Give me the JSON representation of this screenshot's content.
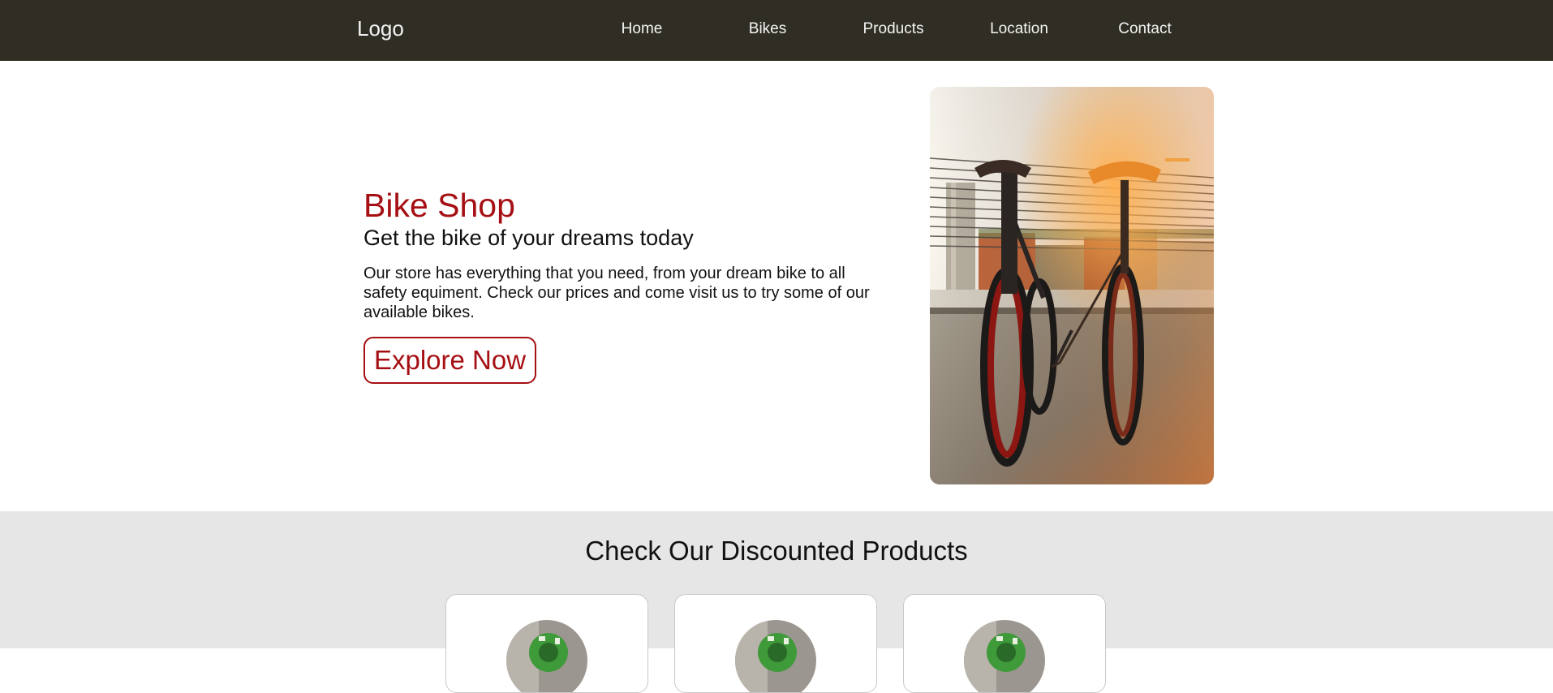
{
  "nav": {
    "logo": "Logo",
    "links": [
      "Home",
      "Bikes",
      "Products",
      "Location",
      "Contact"
    ]
  },
  "hero": {
    "title": "Bike Shop",
    "subtitle": "Get the bike of your dreams today",
    "description": "Our store has everything that you need, from your dream bike to all safety equiment. Check our prices and come visit us to try some of our available bikes.",
    "cta_label": "Explore Now",
    "image_icon": "bicycles-photo"
  },
  "products": {
    "title": "Check Our Discounted Products",
    "cards": [
      {
        "image_icon": "product-photo"
      },
      {
        "image_icon": "product-photo"
      },
      {
        "image_icon": "product-photo"
      }
    ]
  },
  "colors": {
    "nav_bg": "#302e24",
    "accent": "#a50f13",
    "section_bg": "#e6e6e6"
  }
}
